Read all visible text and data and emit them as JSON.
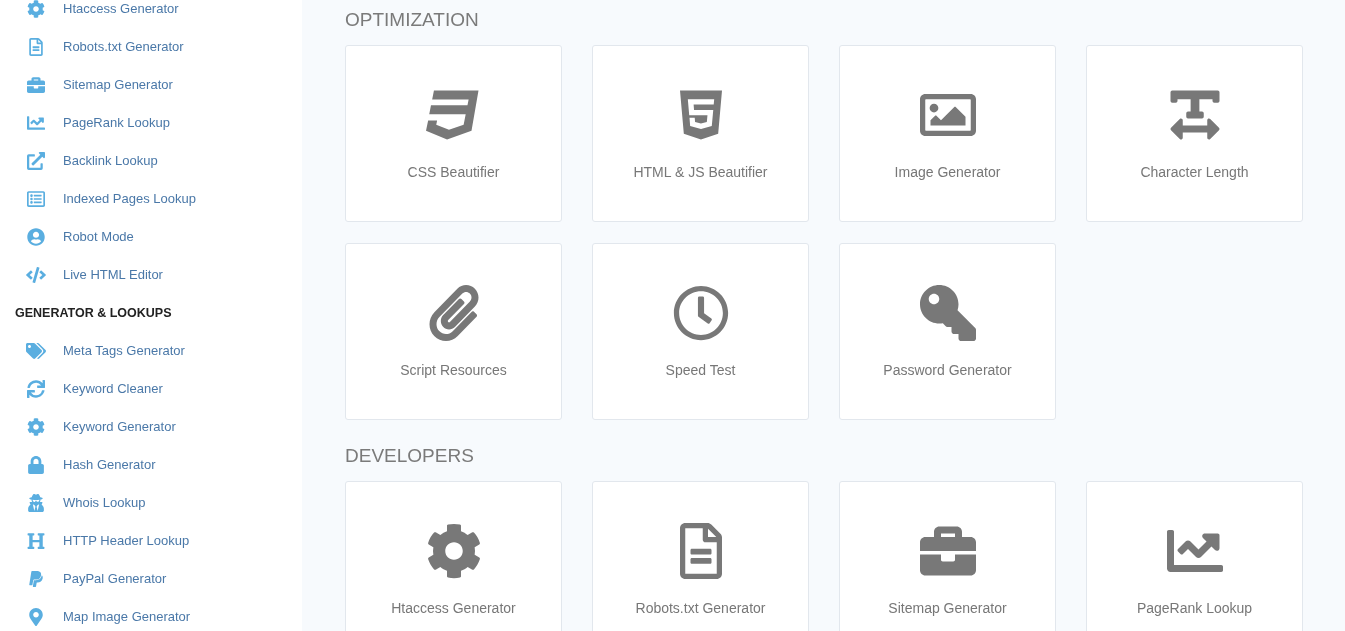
{
  "sidebar": {
    "groups": [
      {
        "items": [
          "Htaccess Generator",
          "Robots.txt Generator",
          "Sitemap Generator",
          "PageRank Lookup",
          "Backlink Lookup",
          "Indexed Pages Lookup",
          "Robot Mode",
          "Live HTML Editor"
        ]
      },
      {
        "heading": "GENERATOR & LOOKUPS",
        "items": [
          "Meta Tags Generator",
          "Keyword Cleaner",
          "Keyword Generator",
          "Hash Generator",
          "Whois Lookup",
          "HTTP Header Lookup",
          "PayPal Generator",
          "Map Image Generator"
        ]
      }
    ]
  },
  "sections": [
    {
      "title": "OPTIMIZATION",
      "cards": [
        "CSS Beautifier",
        "HTML & JS Beautifier",
        "Image Generator",
        "Character Length",
        "Script Resources",
        "Speed Test",
        "Password Generator"
      ]
    },
    {
      "title": "DEVELOPERS",
      "cards": [
        "Htaccess Generator",
        "Robots.txt Generator",
        "Sitemap Generator",
        "PageRank Lookup"
      ]
    }
  ]
}
